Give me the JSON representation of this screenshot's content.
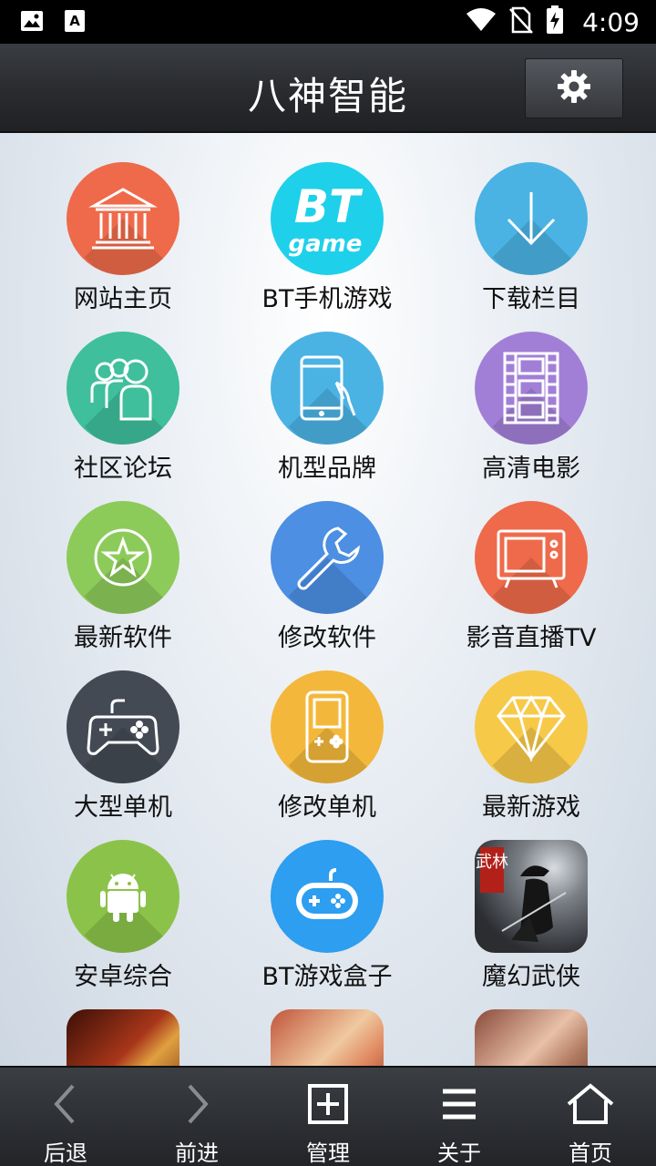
{
  "status_bar": {
    "time": "4:09"
  },
  "header": {
    "title": "八神智能"
  },
  "grid": [
    {
      "label": "网站主页",
      "color": "#ee6a4b",
      "icon": "bank-icon"
    },
    {
      "label": "BT手机游戏",
      "color": "#1fd0ea",
      "icon": "bt-game-icon",
      "logo_text_1": "BT",
      "logo_text_2": "game"
    },
    {
      "label": "下载栏目",
      "color": "#4ab3e4",
      "icon": "download-arrow-icon"
    },
    {
      "label": "社区论坛",
      "color": "#3fbf9c",
      "icon": "people-icon"
    },
    {
      "label": "机型品牌",
      "color": "#4ab3e4",
      "icon": "tablet-hand-icon"
    },
    {
      "label": "高清电影",
      "color": "#a27fd6",
      "icon": "film-icon"
    },
    {
      "label": "最新软件",
      "color": "#8ccb5a",
      "icon": "star-circle-icon"
    },
    {
      "label": "修改软件",
      "color": "#4c8fe3",
      "icon": "wrench-icon"
    },
    {
      "label": "影音直播TV",
      "color": "#ee6a4b",
      "icon": "tv-icon"
    },
    {
      "label": "大型单机",
      "color": "#434a54",
      "icon": "gamepad-icon"
    },
    {
      "label": "修改单机",
      "color": "#f3b83b",
      "icon": "handheld-console-icon"
    },
    {
      "label": "最新游戏",
      "color": "#f7c948",
      "icon": "diamond-icon"
    },
    {
      "label": "安卓综合",
      "color": "#8bc34a",
      "icon": "android-icon"
    },
    {
      "label": "BT游戏盒子",
      "color": "#2d9ef0",
      "icon": "game-controller-icon"
    },
    {
      "label": "魔幻武侠",
      "color": "#3c3f44",
      "icon": "wuxia-game-icon",
      "badge": "武林"
    }
  ],
  "partial_row": [
    {
      "icon": "game-icon-1",
      "color": "#8a2a10"
    },
    {
      "icon": "game-icon-2",
      "color": "#c0553a"
    },
    {
      "icon": "game-icon-3",
      "color": "#b07a60"
    }
  ],
  "bottom_nav": [
    {
      "label": "后退",
      "icon": "chevron-left-icon"
    },
    {
      "label": "前进",
      "icon": "chevron-right-icon"
    },
    {
      "label": "管理",
      "icon": "plus-box-icon"
    },
    {
      "label": "关于",
      "icon": "menu-icon"
    },
    {
      "label": "首页",
      "icon": "home-icon"
    }
  ]
}
